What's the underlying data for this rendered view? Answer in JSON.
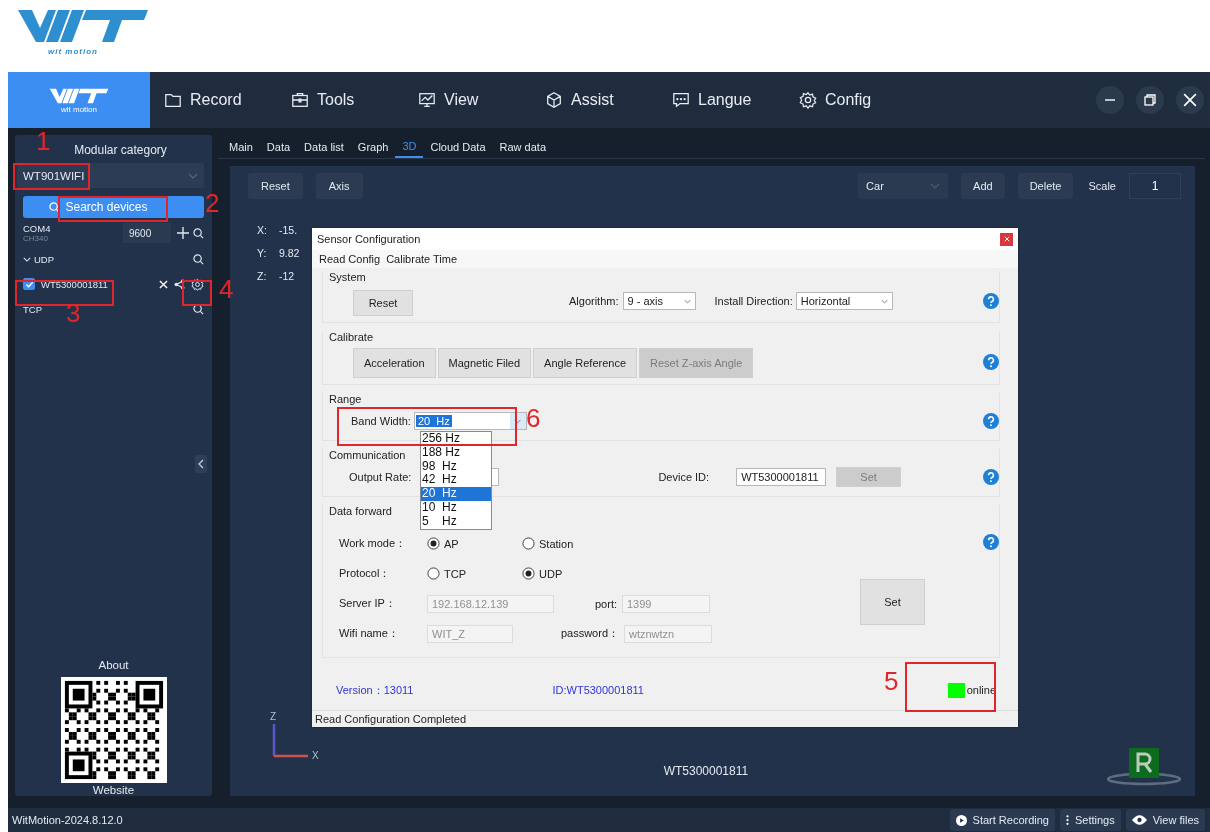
{
  "brand": {
    "tagline": "wit motion"
  },
  "header": {
    "tagline": "wit motion",
    "menu": [
      {
        "label": "Record",
        "kind": "folder"
      },
      {
        "label": "Tools",
        "kind": "toolbox"
      },
      {
        "label": "View",
        "kind": "chart"
      },
      {
        "label": "Assist",
        "kind": "cube"
      },
      {
        "label": "Langue",
        "kind": "chat"
      },
      {
        "label": "Config",
        "kind": "gear"
      }
    ]
  },
  "sidebar": {
    "title": "Modular category",
    "model": "WT901WIFI",
    "search_button": "Search devices",
    "ports": [
      {
        "name": "COM4",
        "driver": "CH340",
        "baud": "9600"
      }
    ],
    "groups": [
      {
        "name": "UDP",
        "expanded": true,
        "devices": [
          {
            "name": "WT5300001811",
            "checked": true
          }
        ]
      },
      {
        "name": "TCP",
        "expanded": false
      }
    ],
    "about": "About",
    "website": "Website"
  },
  "tabs": [
    {
      "label": "Main",
      "selected": false
    },
    {
      "label": "Data",
      "selected": false
    },
    {
      "label": "Data list",
      "selected": false
    },
    {
      "label": "Graph",
      "selected": false
    },
    {
      "label": "3D",
      "selected": true
    },
    {
      "label": "Cloud Data",
      "selected": false
    },
    {
      "label": "Raw data",
      "selected": false
    }
  ],
  "toolbar": {
    "buttons": [
      "Reset",
      "Axis"
    ],
    "model": "Car",
    "actions": [
      "Add",
      "Delete"
    ],
    "scale_label": "Scale",
    "scale": "1"
  },
  "readouts": [
    {
      "axis": "X:",
      "value": "-15."
    },
    {
      "axis": "Y:",
      "value": "9.82"
    },
    {
      "axis": "Z:",
      "value": "-12"
    }
  ],
  "axes": {
    "z": "Z",
    "x": "X"
  },
  "device_label": "WT5300001811",
  "dialog": {
    "title": "Sensor Configuration",
    "menu": [
      "Read Config",
      "Calibrate Time"
    ],
    "system": {
      "title": "System",
      "reset": "Reset",
      "algorithm_label": "Algorithm:",
      "algorithm": "9 - axis",
      "install_label": "Install Direction:",
      "install": "Horizontal"
    },
    "calibrate": {
      "title": "Calibrate",
      "buttons": [
        {
          "label": "Acceleration",
          "disabled": false
        },
        {
          "label": "Magnetic Filed",
          "disabled": false
        },
        {
          "label": "Angle Reference",
          "disabled": false
        },
        {
          "label": "Reset Z-axis Angle",
          "disabled": true
        }
      ]
    },
    "range": {
      "title": "Range",
      "bandwidth_label": "Band Width:",
      "bandwidth": "20  Hz",
      "options": [
        {
          "label": "256 Hz",
          "selected": false
        },
        {
          "label": "188 Hz",
          "selected": false
        },
        {
          "label": "98  Hz",
          "selected": false
        },
        {
          "label": "42  Hz",
          "selected": false
        },
        {
          "label": "20  Hz",
          "selected": true
        },
        {
          "label": "10  Hz",
          "selected": false
        },
        {
          "label": "5    Hz",
          "selected": false
        }
      ]
    },
    "communication": {
      "title": "Communication",
      "output_label": "Output Rate:",
      "device_id_label": "Device ID:",
      "device_id": "WT5300001811",
      "set": "Set",
      "set_disabled": true
    },
    "data_forward": {
      "title": "Data forward",
      "work_mode_label": "Work mode：",
      "work_modes": [
        {
          "label": "AP",
          "selected": true
        },
        {
          "label": "Station",
          "selected": false
        }
      ],
      "protocol_label": "Protocol：",
      "protocols": [
        {
          "label": "TCP",
          "selected": false
        },
        {
          "label": "UDP",
          "selected": true
        }
      ],
      "server_ip_label": "Server IP：",
      "server_ip": "192.168.12.139",
      "port_label": "port:",
      "port": "1399",
      "wifi_label": "Wifi name：",
      "wifi": "WIT_Z",
      "password_label": "password：",
      "password": "wtznwtzn",
      "set": "Set"
    },
    "version": "Version：13011",
    "id": "ID:WT5300001811",
    "online": {
      "label": "online",
      "connected": true
    },
    "status": "Read Configuration Completed"
  },
  "status_bar": {
    "version": "WitMotion-2024.8.12.0",
    "buttons": [
      {
        "label": "Start Recording",
        "kind": "record"
      },
      {
        "label": "Settings",
        "kind": "dots"
      },
      {
        "label": "View files",
        "kind": "eye"
      }
    ]
  },
  "annotations": [
    {
      "label": "1"
    },
    {
      "label": "2"
    },
    {
      "label": "3"
    },
    {
      "label": "4"
    },
    {
      "label": "5"
    },
    {
      "label": "6"
    }
  ]
}
